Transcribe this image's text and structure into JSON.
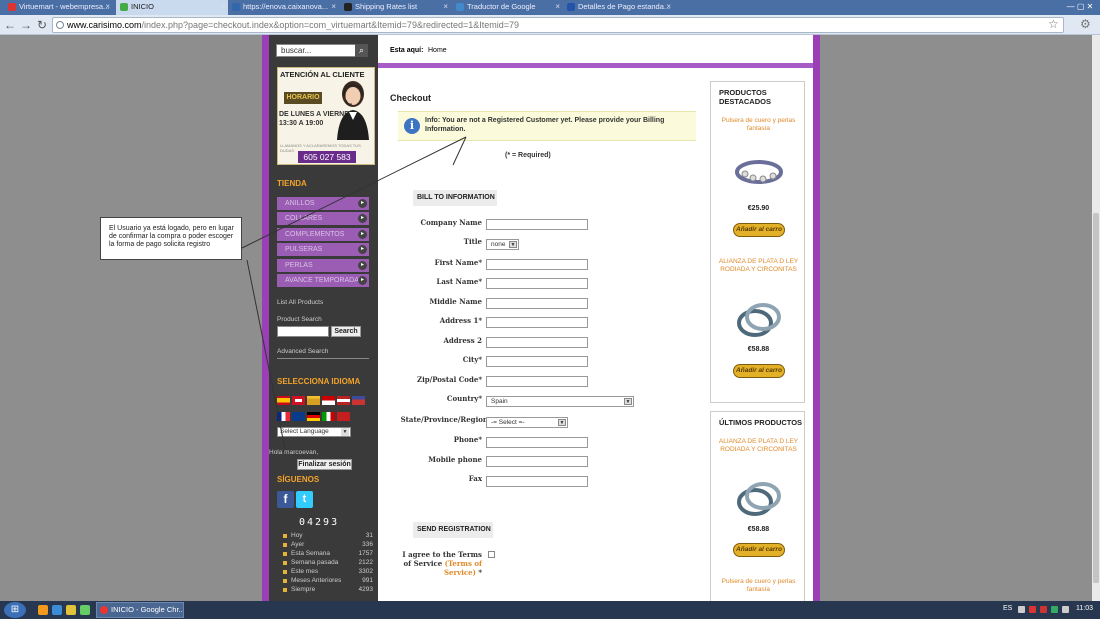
{
  "browser": {
    "tabs": [
      {
        "label": "Virtuemart - webempresa..."
      },
      {
        "label": "INICIO"
      },
      {
        "label": "https://enova.caixanova..."
      },
      {
        "label": "Shipping Rates list"
      },
      {
        "label": "Traductor de Google"
      },
      {
        "label": "Detalles de Pago estanda..."
      }
    ],
    "url_host": "www.carisimo.com",
    "url_rest": "/index.php?page=checkout.index&option=com_virtuemart&Itemid=79&redirected=1&Itemid=79"
  },
  "left": {
    "search_placeholder": "buscar...",
    "customer": {
      "title": "ATENCIÓN AL CLIENTE",
      "horario": "HORARIO",
      "days": "DE LUNES A VIERNES",
      "hours": "13:30 A 19:00",
      "small": "LLAMANOS Y ACLARAREMOS TODAS TUS DUDAS",
      "phone": "605 027 583"
    },
    "tienda_title": "TIENDA",
    "categories": [
      "ANILLOS",
      "COLLARES",
      "COMPLEMENTOS",
      "PULSERAS",
      "PERLAS",
      "AVANCE TEMPORADA"
    ],
    "list_all": "List All Products",
    "product_search": "Product Search",
    "search_btn": "Search",
    "advanced_search": "Advanced Search",
    "idioma_title": "SELECCIONA IDIOMA",
    "select_language": "Select Language",
    "hola": "Hola marcoevan,",
    "logout_btn": "Finalizar sesión",
    "siguenos_title": "SÍGUENOS",
    "counter": "04293",
    "stats": [
      {
        "label": "Hoy",
        "value": "31"
      },
      {
        "label": "Ayer",
        "value": "336"
      },
      {
        "label": "Esta Semana",
        "value": "1757"
      },
      {
        "label": "Semana pasada",
        "value": "2122"
      },
      {
        "label": "Este mes",
        "value": "3302"
      },
      {
        "label": "Meses Anteriores",
        "value": "991"
      },
      {
        "label": "Siempre",
        "value": "4293"
      }
    ]
  },
  "main": {
    "breadcrumb_label": "Esta aquí:",
    "breadcrumb_home": "Home",
    "title": "Checkout",
    "info_text": "Info: You are not a Registered Customer yet. Please provide your Billing Information.",
    "required": "(* = Required)",
    "bill_header": "BILL TO INFORMATION",
    "fields": {
      "company": "Company Name",
      "title": "Title",
      "title_value": "none",
      "first": "First Name*",
      "last": "Last Name*",
      "middle": "Middle Name",
      "address1": "Address 1*",
      "address2": "Address 2",
      "city": "City*",
      "zip": "Zip/Postal Code*",
      "country": "Country*",
      "country_value": "Spain",
      "state": "State/Province/Region",
      "state_value": "-= Select =-",
      "phone": "Phone*",
      "mobile": "Mobile phone",
      "fax": "Fax"
    },
    "send_header": "SEND REGISTRATION",
    "agree_1": "I agree to the Terms",
    "agree_2": "of Service",
    "agree_link": "(Terms of",
    "agree_link2": "Service)",
    "agree_star": "*"
  },
  "right": {
    "featured_title": "PRODUCTOS DESTACADOS",
    "latest_title": "ÚLTIMOS PRODUCTOS",
    "featured": [
      {
        "name": "Pulsera de cuero y perlas fantasía",
        "price": "€25.90"
      },
      {
        "name": "ALIANZA DE PLATA D LEY RODIADA Y CIRCONITAS",
        "price": "€58.88"
      }
    ],
    "latest": [
      {
        "name": "ALIANZA DE PLATA D LEY RODIADA Y CIRCONITAS",
        "price": "€58.88"
      },
      {
        "name": "Pulsera de cuero y perlas fantasía",
        "price": ""
      }
    ],
    "cart_label": "Añadir al carro"
  },
  "annotation": "El Usuario ya está logado, pero en lugar de confirmar la compra o poder escoger la forma de pago solicita registro",
  "taskbar": {
    "chrome": "INICIO - Google Chr...",
    "lang": "ES",
    "time": "11:03"
  },
  "colors": {
    "accent_purple": "#9a3fb5",
    "orange": "#f3a32a",
    "taskbar": "#273750"
  }
}
